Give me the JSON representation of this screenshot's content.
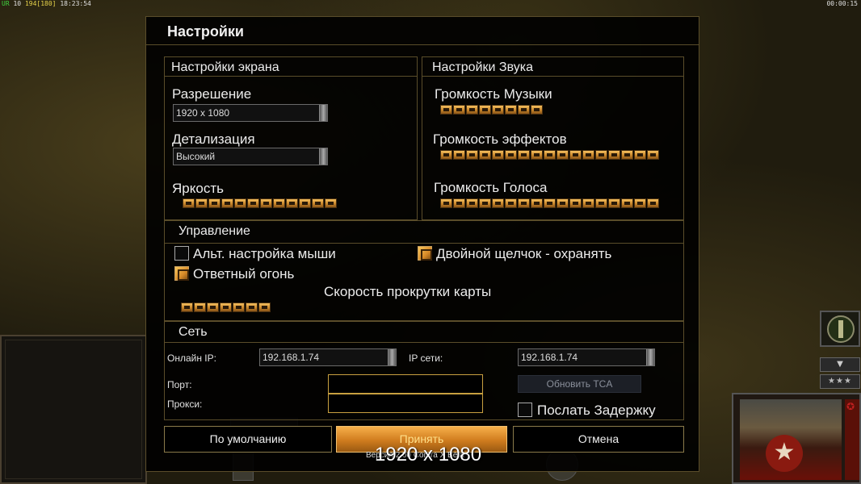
{
  "hud": {
    "left_prefix": "UR",
    "left_a": "10",
    "left_b": "194",
    "left_c": "[180]",
    "left_time": "18:23:54",
    "right_time": "00:00:15"
  },
  "side": {
    "arrow_symbol": "▼",
    "stars": "★★★",
    "portrait_star": "★"
  },
  "dialog": {
    "title": "Настройки",
    "display": {
      "section_title": "Настройки экрана",
      "resolution_label": "Разрешение",
      "resolution_value": "1920 x 1080",
      "detail_label": "Детализация",
      "detail_value": "Высокий",
      "brightness_label": "Яркость",
      "brightness_segments": 12
    },
    "sound": {
      "section_title": "Настройки Звука",
      "music_label": "Громкость Музыки",
      "music_segments": 8,
      "effects_label": "Громкость эффектов",
      "effects_segments": 17,
      "voice_label": "Громкость Голоса",
      "voice_segments": 17
    },
    "controls": {
      "section_title": "Управление",
      "alt_mouse_label": "Альт. настройка мыши",
      "alt_mouse_checked": false,
      "double_click_label": "Двойной щелчок - охранять",
      "double_click_checked": true,
      "return_fire_label": "Ответный огонь",
      "return_fire_checked": true,
      "scroll_speed_label": "Скорость прокрутки карты",
      "scroll_speed_segments": 7
    },
    "network": {
      "section_title": "Сеть",
      "online_ip_label": "Онлайн IP:",
      "online_ip_value": "192.168.1.74",
      "lan_ip_label": "IP сети:",
      "lan_ip_value": "192.168.1.74",
      "port_label": "Порт:",
      "port_value": "",
      "proxy_label": "Прокси:",
      "proxy_value": "",
      "update_tca_label": "Обновить TCA",
      "send_delay_label": "Послать Задержку",
      "send_delay_checked": false
    },
    "footer": {
      "defaults_label": "По умолчанию",
      "accept_label": "Принять",
      "cancel_label": "Отмена",
      "version_text": "Версия 2.00 Contra X Beta",
      "overlay_resolution": "1920 x 1080"
    }
  }
}
